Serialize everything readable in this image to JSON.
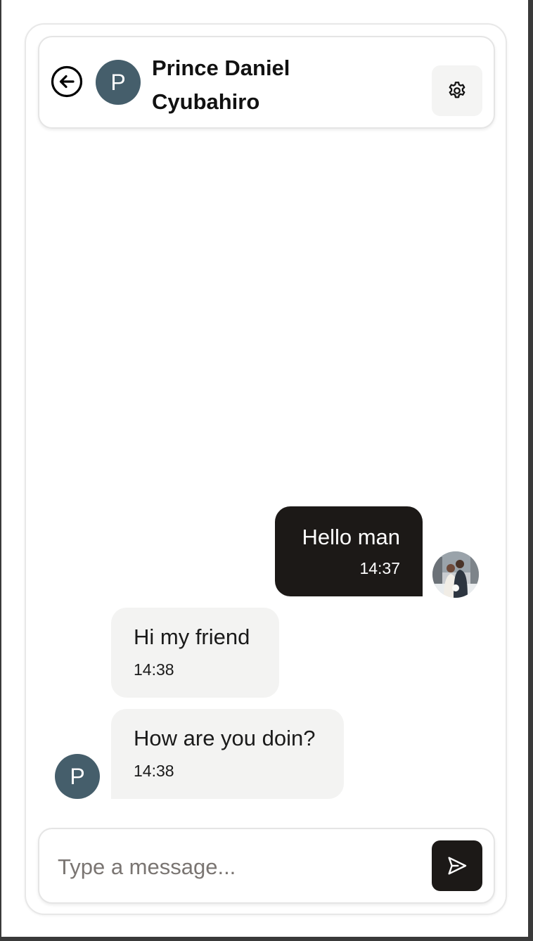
{
  "header": {
    "contact_name": "Prince Daniel Cyubahiro",
    "contact_initial": "P",
    "back_icon": "arrow-left-circle-icon",
    "settings_icon": "gear-icon"
  },
  "messages": [
    {
      "direction": "outgoing",
      "text": "Hello man",
      "time": "14:37"
    },
    {
      "direction": "incoming",
      "text": "Hi my friend",
      "time": "14:38"
    },
    {
      "direction": "incoming",
      "text": "How are you doin?",
      "time": "14:38"
    }
  ],
  "sender_initial": "P",
  "composer": {
    "placeholder": "Type a message...",
    "value": "",
    "send_icon": "send-icon"
  },
  "colors": {
    "accent": "#1c1917",
    "avatar_bg": "#455e6b",
    "incoming_bubble": "#f3f3f2",
    "button_bg": "#f4f4f3"
  }
}
